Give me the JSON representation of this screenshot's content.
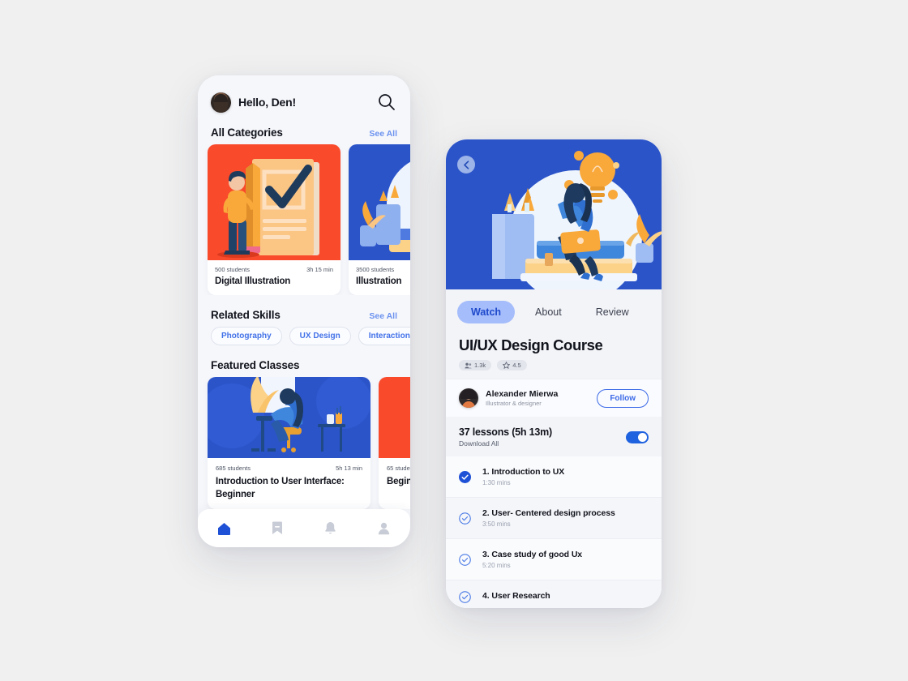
{
  "colors": {
    "accent_blue": "#2b54c9",
    "link_blue": "#6b92ef",
    "chip_blue": "#4272e8",
    "red_card": "#f94a2c",
    "orange": "#f9a83a",
    "page_bg": "#f0f0f0"
  },
  "home": {
    "greeting": "Hello, Den!",
    "avatar_icon": "user-avatar-photo",
    "search_icon": "search-icon",
    "categories_section": {
      "title": "All Categories",
      "see_all": "See All",
      "cards": [
        {
          "students": "500 students",
          "duration": "3h 15 min",
          "name": "Digital Illustration",
          "art": "checklist-person-illustration",
          "bg": "#f94a2c"
        },
        {
          "students": "3500 students",
          "duration": "",
          "name": "Illustration",
          "art": "idea-books-illustration",
          "bg": "#2b54c9"
        }
      ]
    },
    "skills_section": {
      "title": "Related Skills",
      "see_all": "See All",
      "chips": [
        "Photography",
        "UX Design",
        "Interaction"
      ]
    },
    "featured_section": {
      "title": "Featured Classes",
      "cards": [
        {
          "students": "685 students",
          "duration": "5h 13 min",
          "name": "Introduction to User Interface: Beginner",
          "art": "artist-easel-illustration",
          "bg": "#2b54c9"
        },
        {
          "students": "65 stude",
          "duration": "",
          "name": "Begin",
          "art": "red-card-illustration",
          "bg": "#f94a2c"
        }
      ]
    },
    "tabbar": [
      {
        "icon": "home-icon",
        "active": true
      },
      {
        "icon": "bookmark-icon",
        "active": false
      },
      {
        "icon": "bell-icon",
        "active": false
      },
      {
        "icon": "person-icon",
        "active": false
      }
    ]
  },
  "detail": {
    "back_icon": "chevron-left-icon",
    "hero_art": "woman-laptop-books-illustration",
    "tabs": [
      {
        "label": "Watch",
        "active": true
      },
      {
        "label": "About",
        "active": false
      },
      {
        "label": "Review",
        "active": false
      }
    ],
    "course_title": "UI/UX Design Course",
    "badges": [
      {
        "icon": "people-icon",
        "value": "1.3k"
      },
      {
        "icon": "star-icon",
        "value": "4.5"
      }
    ],
    "author": {
      "avatar_icon": "author-avatar-photo",
      "name": "Alexander Mierwa",
      "role": "Illustrator & designer",
      "follow_label": "Follow"
    },
    "lessons_header": {
      "count": "37 lessons (5h 13m)",
      "subtitle": "Download All",
      "toggle_on": true
    },
    "lessons": [
      {
        "title": "1. Introduction to UX",
        "duration": "1:30 mins",
        "state": "completed"
      },
      {
        "title": "2. User- Centered design process",
        "duration": "3:50 mins",
        "state": "pending"
      },
      {
        "title": "3. Case study of good Ux",
        "duration": "5:20 mins",
        "state": "pending"
      },
      {
        "title": "4. User Research",
        "duration": "",
        "state": "pending"
      }
    ]
  }
}
